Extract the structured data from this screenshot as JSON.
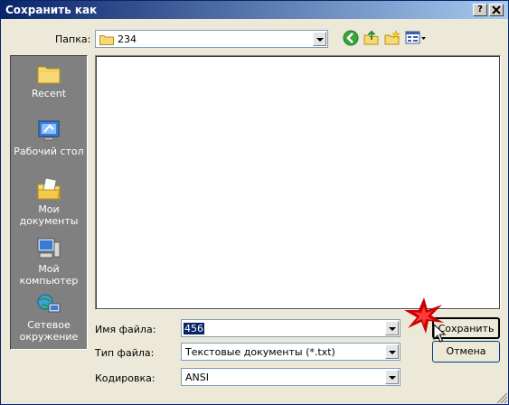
{
  "window": {
    "title": "Сохранить как",
    "help_button": "?",
    "close_button": "X"
  },
  "folder_bar": {
    "label": "Папка:",
    "value": "234"
  },
  "places": [
    {
      "label": "Recent",
      "icon": "recent-folder-icon"
    },
    {
      "label": "Рабочий стол",
      "icon": "desktop-icon"
    },
    {
      "label": "Мои документы",
      "icon": "my-documents-icon"
    },
    {
      "label": "Мой компьютер",
      "icon": "my-computer-icon"
    },
    {
      "label": "Сетевое окружение",
      "icon": "network-icon"
    }
  ],
  "form": {
    "filename_label": "Имя файла:",
    "filename_value": "456",
    "filetype_label": "Тип файла:",
    "filetype_value": "Текстовые документы (*.txt)",
    "encoding_label": "Кодировка:",
    "encoding_value": "ANSI"
  },
  "buttons": {
    "save": "Сохранить",
    "cancel": "Отмена"
  },
  "colors": {
    "title_start": "#0a246a",
    "title_end": "#a6caf0",
    "dialog_bg": "#ece9d8",
    "places_bg": "#808080",
    "highlight": "#0a246a",
    "star": "#cc0000"
  }
}
